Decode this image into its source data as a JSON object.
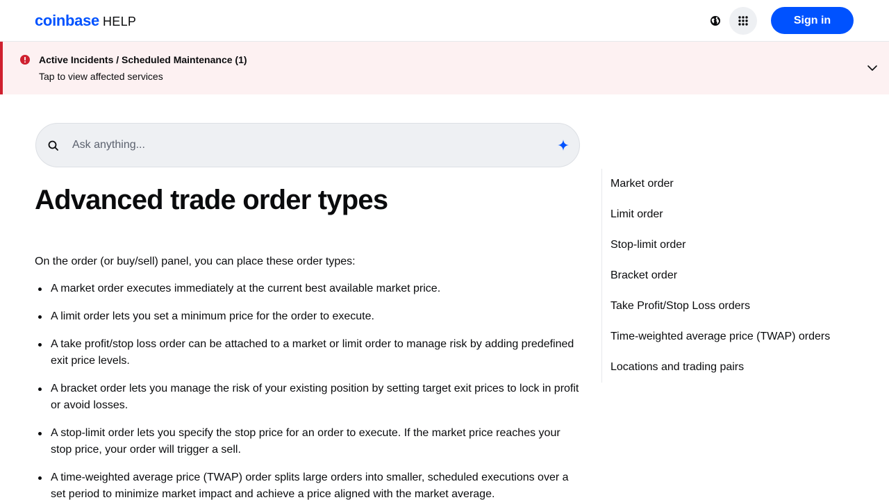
{
  "header": {
    "brand": "coinbase",
    "brand_suffix": "HELP",
    "sign_in_label": "Sign in",
    "brand_color": "#0052ff"
  },
  "banner": {
    "title": "Active Incidents / Scheduled Maintenance (1)",
    "subtitle": "Tap to view affected services",
    "accent_color": "#cf202f",
    "icon": "alert-circle-icon"
  },
  "search": {
    "placeholder": "Ask anything..."
  },
  "article": {
    "title": "Advanced trade order types",
    "intro": "On the order (or buy/sell) panel, you can place these order types:",
    "bullets": [
      "A market order executes immediately at the current best available market price.",
      "A limit order lets you set a minimum price for the order to execute.",
      "A take profit/stop loss order can be attached to a market or limit order to manage risk by adding predefined exit price levels.",
      "A bracket order lets you manage the risk of your existing position by setting target exit prices to lock in profit or avoid losses.",
      "A stop-limit order lets you specify the stop price for an order to execute. If the market price reaches your stop price, your order will trigger a sell.",
      "A time-weighted average price (TWAP) order splits large orders into smaller, scheduled executions over a set period to minimize market impact and achieve a price aligned with the market average."
    ]
  },
  "toc": {
    "items": [
      "Market order",
      "Limit order",
      "Stop-limit order",
      "Bracket order",
      "Take Profit/Stop Loss orders",
      "Time-weighted average price (TWAP) orders",
      "Locations and trading pairs"
    ]
  }
}
